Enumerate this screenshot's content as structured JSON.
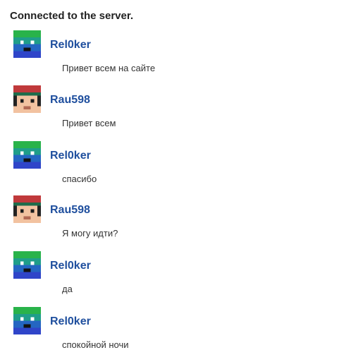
{
  "status": "Connected to the server.",
  "messages": [
    {
      "user": "Rel0ker",
      "avatar": "blue-green-pixel-face-icon",
      "text": "Привет всем на сайте"
    },
    {
      "user": "Rau598",
      "avatar": "red-cap-pixel-face-icon",
      "text": "Привет всем"
    },
    {
      "user": "Rel0ker",
      "avatar": "blue-green-pixel-face-icon",
      "text": "спасибо"
    },
    {
      "user": "Rau598",
      "avatar": "red-cap-pixel-face-icon",
      "text": "Я могу идти?"
    },
    {
      "user": "Rel0ker",
      "avatar": "blue-green-pixel-face-icon",
      "text": "да"
    },
    {
      "user": "Rel0ker",
      "avatar": "blue-green-pixel-face-icon",
      "text": "спокойной ночи"
    }
  ]
}
